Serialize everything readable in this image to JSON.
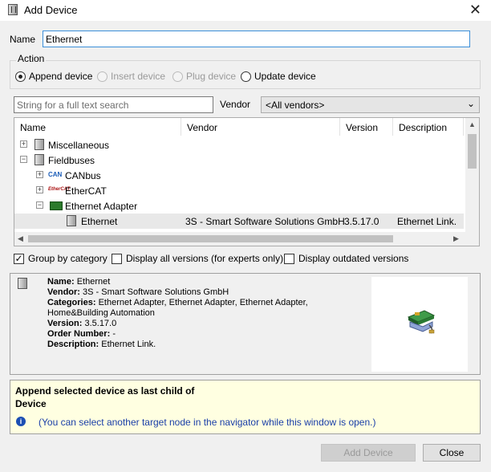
{
  "window": {
    "title": "Add Device",
    "close": "✕"
  },
  "name_field": {
    "label": "Name",
    "value": "Ethernet"
  },
  "action": {
    "legend": "Action",
    "options": [
      {
        "label": "Append device",
        "checked": true,
        "disabled": false
      },
      {
        "label": "Insert device",
        "checked": false,
        "disabled": true
      },
      {
        "label": "Plug device",
        "checked": false,
        "disabled": true
      },
      {
        "label": "Update device",
        "checked": false,
        "disabled": false
      }
    ]
  },
  "search": {
    "placeholder": "String for a full text search",
    "vendor_label": "Vendor",
    "vendor_value": "<All vendors>"
  },
  "tree": {
    "columns": [
      "Name",
      "Vendor",
      "Version",
      "Description"
    ],
    "rows": [
      {
        "name": "Miscellaneous",
        "icon": "device-icon",
        "expander": "+"
      },
      {
        "name": "Fieldbuses",
        "icon": "device-icon",
        "expander": "−"
      },
      {
        "name": "CANbus",
        "icon": "canbus-icon",
        "expander": "+",
        "icon_text": "CAN"
      },
      {
        "name": "EtherCAT",
        "icon": "ethercat-icon",
        "expander": "+",
        "icon_text": "EtherCAT"
      },
      {
        "name": "Ethernet Adapter",
        "icon": "ethernet-adapter-icon",
        "expander": "−"
      },
      {
        "name": "Ethernet",
        "icon": "device-icon",
        "vendor": "3S - Smart Software Solutions GmbH",
        "version": "3.5.17.0",
        "description": "Ethernet Link."
      }
    ]
  },
  "options": {
    "group_by_category": {
      "label": "Group by category",
      "checked": true
    },
    "display_all_versions": {
      "label": "Display all versions (for experts only)",
      "checked": false
    },
    "display_outdated": {
      "label": "Display outdated versions",
      "checked": false
    }
  },
  "details": {
    "name_key": "Name:",
    "name_val": "Ethernet",
    "vendor_key": "Vendor:",
    "vendor_val": "3S - Smart Software Solutions GmbH",
    "categories_key": "Categories:",
    "categories_val": "Ethernet Adapter, Ethernet Adapter, Ethernet Adapter,",
    "categories_val2": "Home&Building Automation",
    "version_key": "Version:",
    "version_val": "3.5.17.0",
    "order_key": "Order Number:",
    "order_val": "-",
    "description_key": "Description:",
    "description_val": "Ethernet Link."
  },
  "hint": {
    "line1": "Append selected device as last child of",
    "line2": "Device",
    "note": "(You can select another target node in the navigator while this window is open.)"
  },
  "buttons": {
    "add": "Add Device",
    "close": "Close"
  },
  "colors": {
    "accent": "#3b8fd9",
    "hint_bg": "#ffffe1",
    "hint_text": "#1a3ea8"
  }
}
